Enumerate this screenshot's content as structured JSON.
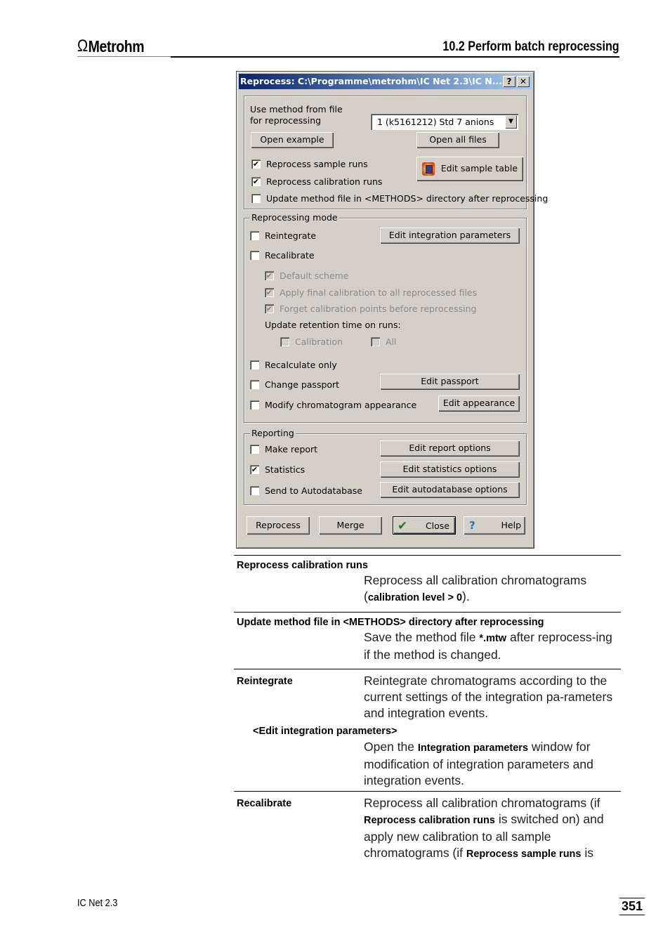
{
  "header": {
    "logo_symbol": "Ω",
    "logo_text": "Metrohm",
    "section_title": "10.2  Perform batch reprocessing"
  },
  "dialog": {
    "title": "Reprocess: C:\\Programme\\metrohm\\IC Net 2.3\\IC N...",
    "help_button": "?",
    "close_button": "✕",
    "method_label_line1": "Use method from file",
    "method_label_line2": "for reprocessing",
    "method_select_value": "1  (k5161212)  Std 7 anions",
    "open_example": "Open example",
    "open_all_files": "Open all files",
    "edit_sample_table": "Edit sample table",
    "reprocess_sample_runs": {
      "label": "Reprocess sample runs",
      "checked": true
    },
    "reprocess_calibration_runs": {
      "label": "Reprocess calibration runs",
      "checked": true
    },
    "update_method_file": {
      "label": "Update method file in <METHODS> directory after reprocessing",
      "checked": false
    },
    "reprocessing_mode": {
      "label": "Reprocessing mode",
      "reintegrate": {
        "label": "Reintegrate",
        "checked": false
      },
      "edit_integration_parameters": "Edit integration parameters",
      "recalibrate": {
        "label": "Recalibrate",
        "checked": false
      },
      "default_scheme": {
        "label": "Default scheme",
        "checked": true
      },
      "apply_final_calibration": {
        "label": "Apply final calibration to all reprocessed files",
        "checked": true
      },
      "forget_calibration_points": {
        "label": "Forget calibration points before reprocessing",
        "checked": true
      },
      "update_retention_label": "Update retention time on runs:",
      "calibration": {
        "label": "Calibration",
        "checked": false
      },
      "all": {
        "label": "All",
        "checked": false
      },
      "recalculate_only": {
        "label": "Recalculate only",
        "checked": false
      },
      "change_passport": {
        "label": "Change passport",
        "checked": false
      },
      "edit_passport": "Edit passport",
      "modify_chromatogram": {
        "label": "Modify chromatogram appearance",
        "checked": false
      },
      "edit_appearance": "Edit appearance"
    },
    "reporting": {
      "label": "Reporting",
      "make_report": {
        "label": "Make report",
        "checked": false
      },
      "edit_report_options": "Edit report options",
      "statistics": {
        "label": "Statistics",
        "checked": true
      },
      "edit_statistics_options": "Edit statistics options",
      "send_to_autodatabase": {
        "label": "Send to Autodatabase",
        "checked": false
      },
      "edit_autodatabase_options": "Edit autodatabase options"
    },
    "buttons": {
      "reprocess": "Reprocess",
      "merge": "Merge",
      "close": "Close",
      "help": "Help"
    },
    "check_mark": "✔"
  },
  "doc": {
    "entry1_term": "Reprocess calibration runs",
    "entry1_desc_a": "Reprocess all calibration chromatograms (",
    "entry1_desc_b": "calibration level > 0",
    "entry1_desc_c": ").",
    "entry2_term": "Update method file in <METHODS> directory after reprocessing",
    "entry2_desc_a": "Save the method file ",
    "entry2_desc_b": "*.mtw",
    "entry2_desc_c": " after reprocess-ing if the method is changed.",
    "entry3_term": "Reintegrate",
    "entry3_desc": "Reintegrate chromatograms according to the current settings of the integration pa-rameters and integration events.",
    "entry3_sub_term": "<Edit integration parameters>",
    "entry3_sub_desc_a": "Open the ",
    "entry3_sub_desc_b": "Integration parameters",
    "entry3_sub_desc_c": " window for modification of integration parameters and integration events.",
    "entry4_term": "Recalibrate",
    "entry4_desc_a": "Reprocess all calibration chromatograms (if ",
    "entry4_desc_b": "Reprocess calibration runs",
    "entry4_desc_c": " is switched on) and apply new calibration to all sample chromatograms (if ",
    "entry4_desc_d": "Reprocess sample runs",
    "entry4_desc_e": " is"
  },
  "footer": {
    "product": "IC Net 2.3",
    "page_number": "351"
  }
}
